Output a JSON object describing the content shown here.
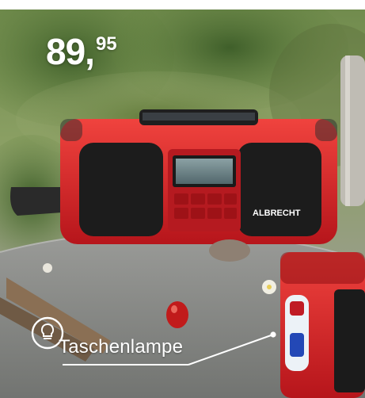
{
  "price": {
    "main": "89",
    "separator": ",",
    "cents": "95"
  },
  "feature_label": "Taschenlampe",
  "brand_on_radio": "ALBRECHT",
  "icons": {
    "feature_icon": "lightbulb-icon"
  },
  "colors": {
    "radio_red": "#d81e23",
    "text": "#ffffff"
  }
}
